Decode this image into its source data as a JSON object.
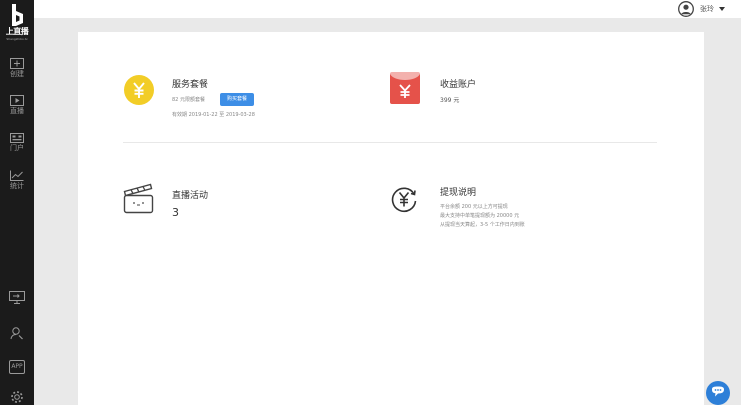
{
  "sidebar": {
    "logo_text": "上直播",
    "logo_sub": "Shangzhibo.tv",
    "items": [
      {
        "label": "创建",
        "icon": "plus-square-icon"
      },
      {
        "label": "直播",
        "icon": "play-square-icon"
      },
      {
        "label": "门户",
        "icon": "portal-icon"
      },
      {
        "label": "统计",
        "icon": "chart-line-icon"
      }
    ],
    "bottom_items": [
      {
        "icon": "screen-share-icon"
      },
      {
        "icon": "user-search-icon"
      },
      {
        "label": "APP",
        "icon": "app-icon"
      },
      {
        "icon": "gear-icon"
      }
    ]
  },
  "topbar": {
    "username": "张玲",
    "avatar_icon": "user-avatar-icon"
  },
  "service": {
    "title": "服务套餐",
    "plan": "82 元限额套餐",
    "buy_label": "购买套餐",
    "validity": "有效期   2019-01-22 至 2019-03-28",
    "icon": "yen-circle-icon",
    "icon_color": "#f2cd27"
  },
  "income": {
    "title": "收益账户",
    "amount": "399 元",
    "icon": "red-envelope-icon",
    "icon_color": "#e5524a"
  },
  "live": {
    "title": "直播活动",
    "count": "3",
    "icon": "clapperboard-icon"
  },
  "withdraw": {
    "title": "提现说明",
    "lines": [
      "平台余额 200 元以上方可提现",
      "最大支持中单笔提现额为 20000 元",
      "从提现当天算起，3-5 个工作日内到账"
    ],
    "icon": "yen-cycle-icon"
  },
  "chat": {
    "icon": "chat-bubble-icon",
    "color": "#2d7fd8"
  }
}
